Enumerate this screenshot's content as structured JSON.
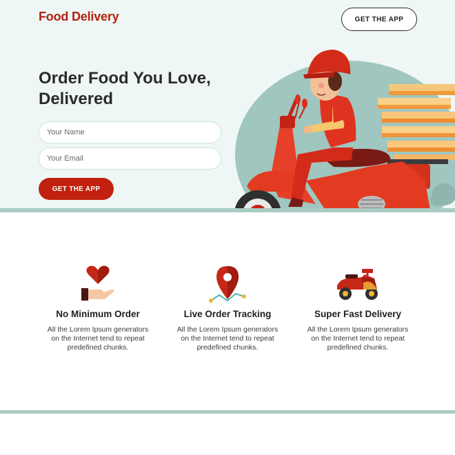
{
  "header": {
    "brand": "Food Delivery",
    "cta_label": "GET THE APP"
  },
  "hero": {
    "headline_line1": "Order Food You Love,",
    "headline_line2": "Delivered",
    "form": {
      "name_placeholder": "Your Name",
      "email_placeholder": "Your Email",
      "submit_label": "GET THE APP"
    }
  },
  "features": [
    {
      "icon": "heart-hand-icon",
      "title": "No Minimum Order",
      "text_line1": "All the Lorem Ipsum generators",
      "text_line2": "on the Internet tend to repeat",
      "text_line3": "predefined chunks."
    },
    {
      "icon": "location-pin-icon",
      "title": "Live Order Tracking",
      "text_line1": "All the Lorem Ipsum generators",
      "text_line2": "on the Internet tend to repeat",
      "text_line3": "predefined chunks."
    },
    {
      "icon": "scooter-icon",
      "title": "Super Fast Delivery",
      "text_line1": "All the Lorem Ipsum generators",
      "text_line2": "on the Internet tend to repeat",
      "text_line3": "predefined chunks."
    }
  ],
  "colors": {
    "brand": "#b4200f",
    "accent": "#c2210f",
    "hero_bg": "#eef7f5",
    "stripe": "#a9cbc4"
  }
}
